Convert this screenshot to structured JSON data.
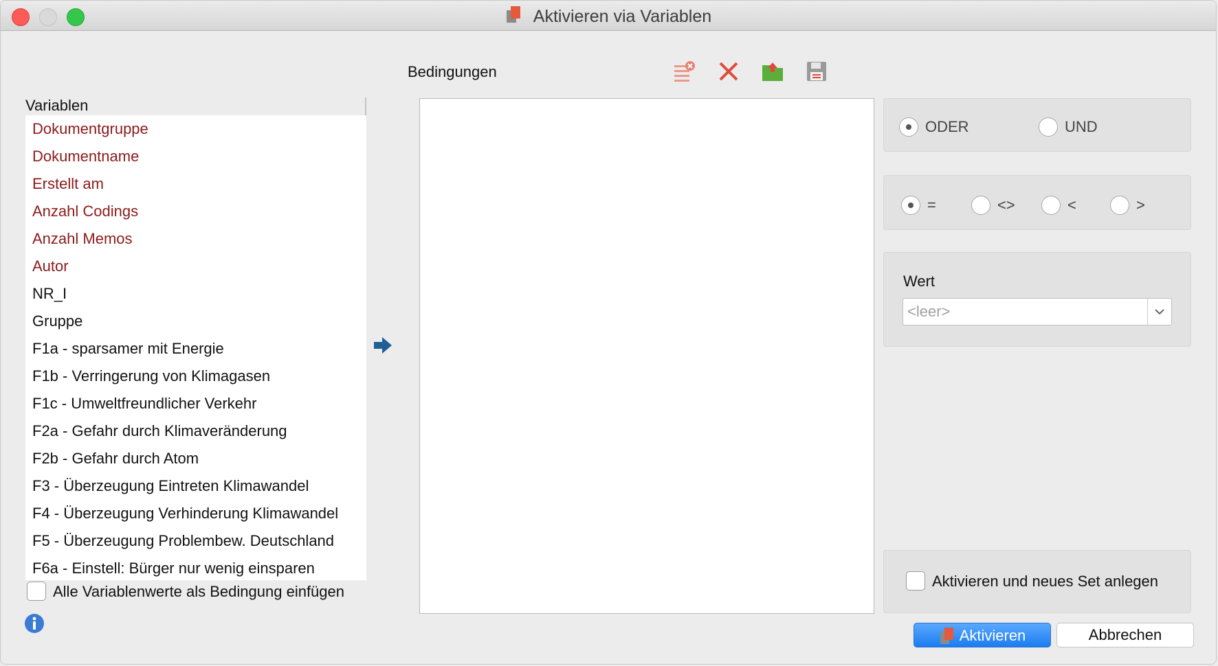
{
  "window": {
    "title": "Aktivieren via Variablen"
  },
  "variables": {
    "header": "Variablen",
    "items": [
      {
        "label": "Dokumentgruppe",
        "system": true
      },
      {
        "label": "Dokumentname",
        "system": true
      },
      {
        "label": "Erstellt am",
        "system": true
      },
      {
        "label": "Anzahl Codings",
        "system": true
      },
      {
        "label": "Anzahl Memos",
        "system": true
      },
      {
        "label": "Autor",
        "system": true
      },
      {
        "label": "NR_I",
        "system": false
      },
      {
        "label": "Gruppe",
        "system": false
      },
      {
        "label": "F1a - sparsamer mit Energie",
        "system": false
      },
      {
        "label": "F1b - Verringerung von Klimagasen",
        "system": false
      },
      {
        "label": "F1c - Umweltfreundlicher Verkehr",
        "system": false
      },
      {
        "label": "F2a - Gefahr durch Klimaveränderung",
        "system": false
      },
      {
        "label": "F2b - Gefahr durch Atom",
        "system": false
      },
      {
        "label": "F3 - Überzeugung Eintreten Klimawandel",
        "system": false
      },
      {
        "label": "F4 - Überzeugung Verhinderung Klimawandel",
        "system": false
      },
      {
        "label": "F5 - Überzeugung Problembew. Deutschland",
        "system": false
      },
      {
        "label": "F6a - Einstell: Bürger nur wenig einsparen",
        "system": false
      }
    ],
    "insert_all_label": "Alle Variablenwerte als Bedingung einfügen",
    "insert_all_checked": false
  },
  "conditions": {
    "label": "Bedingungen"
  },
  "logic": {
    "oder_label": "ODER",
    "und_label": "UND",
    "selected": "ODER"
  },
  "operators": {
    "eq": "=",
    "ne": "<>",
    "lt": "<",
    "gt": ">",
    "selected": "="
  },
  "value": {
    "label": "Wert",
    "placeholder": "<leer>"
  },
  "new_set": {
    "label": "Aktivieren und neues Set anlegen",
    "checked": false
  },
  "buttons": {
    "activate": "Aktivieren",
    "cancel": "Abbrechen"
  },
  "colors": {
    "system_variable": "#8b1b1b",
    "accent_blue": "#1b7cf0",
    "arrow_blue": "#1f5f95",
    "delete_red": "#e04a3a"
  }
}
